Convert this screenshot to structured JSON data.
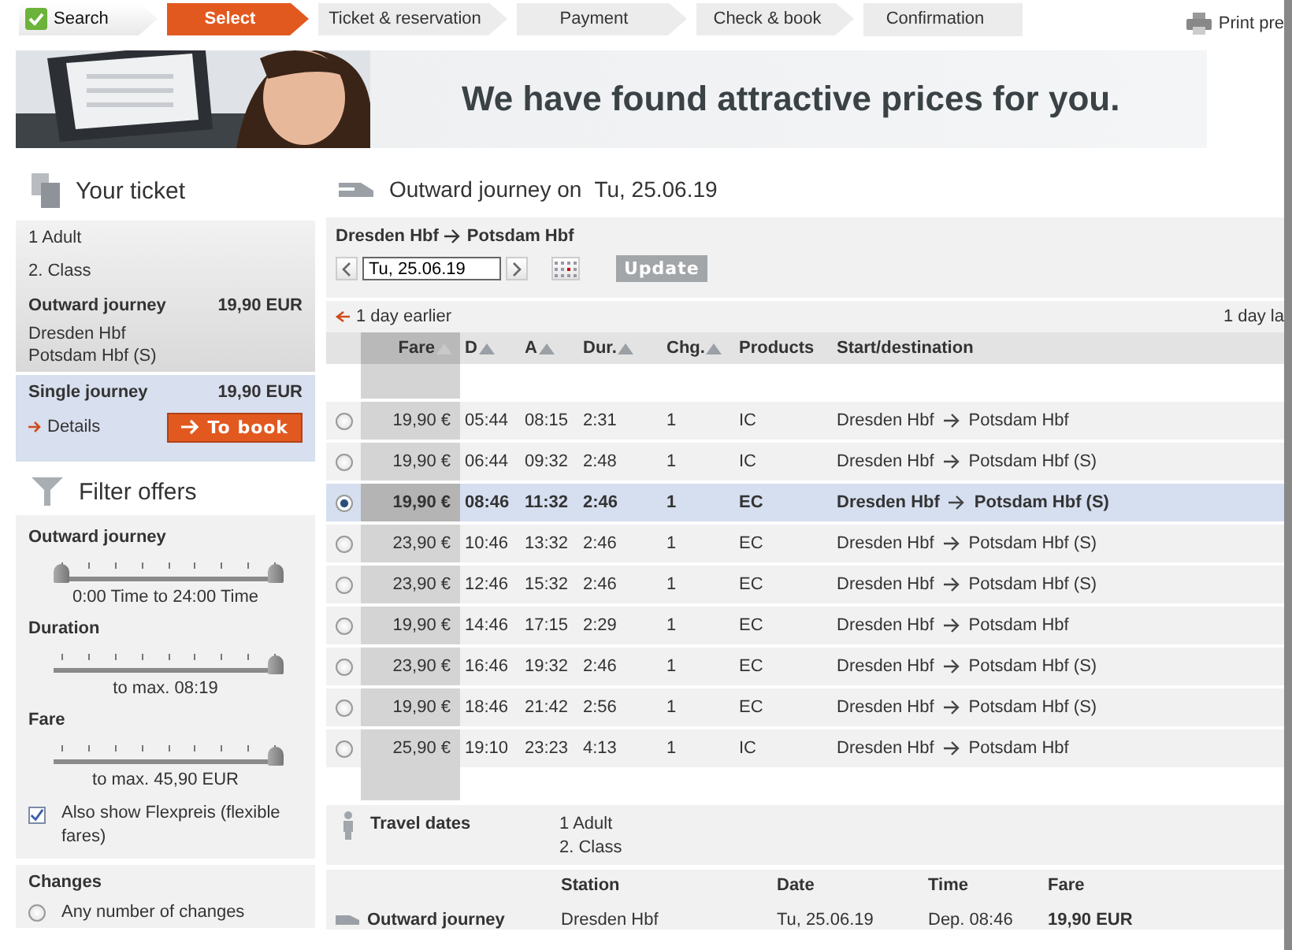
{
  "steps": [
    {
      "label": "Search",
      "done": true,
      "selected": false
    },
    {
      "label": "Select",
      "done": false,
      "selected": true
    },
    {
      "label": "Ticket & reservation",
      "done": false,
      "selected": false
    },
    {
      "label": "Payment",
      "done": false,
      "selected": false
    },
    {
      "label": "Check & book",
      "done": false,
      "selected": false
    },
    {
      "label": "Confirmation",
      "done": false,
      "selected": false
    }
  ],
  "print": {
    "label": "Print pre"
  },
  "banner": {
    "headline": "We have found attractive prices for you."
  },
  "ticket": {
    "title": "Your ticket",
    "lines": [
      "1 Adult",
      "2. Class"
    ],
    "journey": {
      "label": "Outward journey",
      "price": "19,90 EUR",
      "stations": [
        "Dresden Hbf",
        "Potsdam Hbf (S)"
      ]
    },
    "total": {
      "label": "Single journey",
      "price": "19,90 EUR",
      "details": "Details",
      "book": "To book"
    }
  },
  "filter": {
    "title": "Filter offers",
    "sliders": [
      {
        "label": "Outward journey",
        "thumbs": [
          {
            "level": 0
          },
          {
            "level": 1
          }
        ],
        "reading": "0:00 Time to 24:00 Time"
      },
      {
        "label": "Duration",
        "thumbs": [
          {
            "level": 1
          }
        ],
        "reading": "to max. 08:19"
      },
      {
        "label": "Fare",
        "thumbs": [
          {
            "level": 1
          }
        ],
        "reading": "to max. 45,90 EUR"
      }
    ],
    "flexpreis": {
      "label": "Also show Flexpreis (flexible fares)",
      "checked": true
    },
    "changes": {
      "title": "Changes",
      "options": [
        {
          "label": "Any number of changes",
          "selected": false
        }
      ]
    }
  },
  "journey": {
    "title": "Outward journey on",
    "date": "Tu, 25.06.19",
    "from": "Dresden Hbf",
    "to": "Potsdam Hbf",
    "date_field": "Tu, 25.06.19",
    "update": "Update",
    "earlier": "1 day earlier",
    "later": "1 day la"
  },
  "table": {
    "columns": [
      {
        "label": "Fare",
        "sortable": true,
        "selected": true
      },
      {
        "label": "D",
        "sortable": true,
        "selected": false
      },
      {
        "label": "A",
        "sortable": true,
        "selected": false
      },
      {
        "label": "Dur.",
        "sortable": true,
        "selected": false
      },
      {
        "label": "Chg.",
        "sortable": true,
        "selected": false
      },
      {
        "label": "Products",
        "sortable": false,
        "selected": false
      },
      {
        "label": "Start/destination",
        "sortable": false,
        "selected": false
      }
    ],
    "rows": [
      {
        "selected": false,
        "fare": "19,90 €",
        "dep": "05:44",
        "arr": "08:15",
        "dur": "2:31",
        "chg": "1",
        "product": "IC",
        "from": "Dresden Hbf",
        "to": "Potsdam Hbf"
      },
      {
        "selected": false,
        "fare": "19,90 €",
        "dep": "06:44",
        "arr": "09:32",
        "dur": "2:48",
        "chg": "1",
        "product": "IC",
        "from": "Dresden Hbf",
        "to": "Potsdam Hbf (S)"
      },
      {
        "selected": true,
        "fare": "19,90 €",
        "dep": "08:46",
        "arr": "11:32",
        "dur": "2:46",
        "chg": "1",
        "product": "EC",
        "from": "Dresden Hbf",
        "to": "Potsdam Hbf (S)"
      },
      {
        "selected": false,
        "fare": "23,90 €",
        "dep": "10:46",
        "arr": "13:32",
        "dur": "2:46",
        "chg": "1",
        "product": "EC",
        "from": "Dresden Hbf",
        "to": "Potsdam Hbf (S)"
      },
      {
        "selected": false,
        "fare": "23,90 €",
        "dep": "12:46",
        "arr": "15:32",
        "dur": "2:46",
        "chg": "1",
        "product": "EC",
        "from": "Dresden Hbf",
        "to": "Potsdam Hbf (S)"
      },
      {
        "selected": false,
        "fare": "19,90 €",
        "dep": "14:46",
        "arr": "17:15",
        "dur": "2:29",
        "chg": "1",
        "product": "EC",
        "from": "Dresden Hbf",
        "to": "Potsdam Hbf"
      },
      {
        "selected": false,
        "fare": "23,90 €",
        "dep": "16:46",
        "arr": "19:32",
        "dur": "2:46",
        "chg": "1",
        "product": "EC",
        "from": "Dresden Hbf",
        "to": "Potsdam Hbf (S)"
      },
      {
        "selected": false,
        "fare": "19,90 €",
        "dep": "18:46",
        "arr": "21:42",
        "dur": "2:56",
        "chg": "1",
        "product": "EC",
        "from": "Dresden Hbf",
        "to": "Potsdam Hbf (S)"
      },
      {
        "selected": false,
        "fare": "25,90 €",
        "dep": "19:10",
        "arr": "23:23",
        "dur": "4:13",
        "chg": "1",
        "product": "IC",
        "from": "Dresden Hbf",
        "to": "Potsdam Hbf"
      }
    ]
  },
  "travel_dates": {
    "label": "Travel dates",
    "lines": [
      "1 Adult",
      "2. Class"
    ]
  },
  "summary": {
    "columns": [
      "Station",
      "Date",
      "Time",
      "Fare"
    ],
    "row": {
      "label": "Outward journey",
      "station": "Dresden Hbf",
      "date": "Tu, 25.06.19",
      "time": "Dep. 08:46",
      "fare": "19,90 EUR"
    }
  }
}
